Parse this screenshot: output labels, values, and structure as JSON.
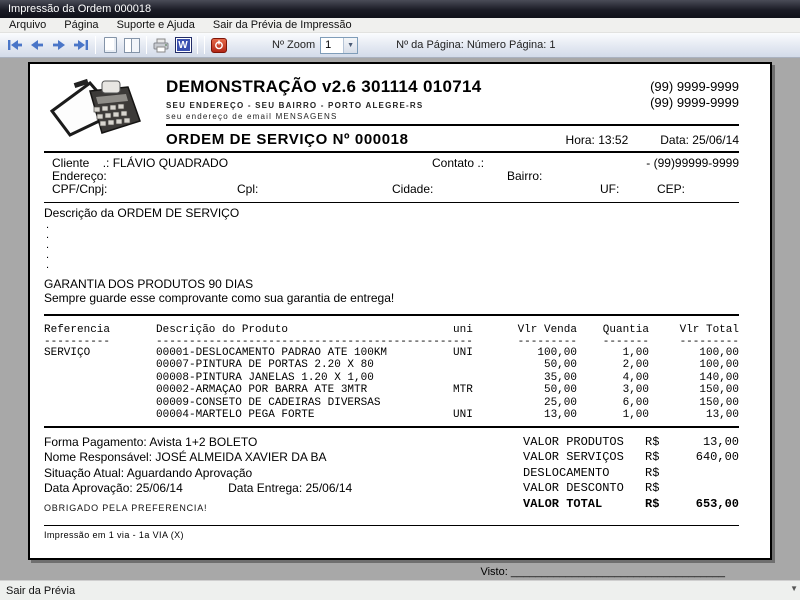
{
  "window": {
    "title": "Impressão da Ordem 000018",
    "menu": [
      "Arquivo",
      "Página",
      "Suporte e Ajuda",
      "Sair da Prévia de Impressão"
    ],
    "toolbar": {
      "zoom_label": "Nº Zoom",
      "zoom_value": "1",
      "page_info": "Nº da Página: Número Página: 1"
    },
    "status": "Sair da Prévia"
  },
  "doc": {
    "company": {
      "title": "DEMONSTRAÇÃO v2.6 301114 010714",
      "address": "SEU ENDEREÇO - SEU BAIRRO - PORTO ALEGRE-RS",
      "email": "seu endereço de email MENSAGENS",
      "phone1": "(99) 9999-9999",
      "phone2": "(99) 9999-9999"
    },
    "order": {
      "title": "ORDEM DE SERVIÇO Nº 000018",
      "time": "Hora: 13:52",
      "date": "Data: 25/06/14"
    },
    "client": {
      "cliente_label": "Cliente    .: ",
      "cliente_value": "FLÁVIO QUADRADO",
      "contato_label": "Contato .:",
      "contato_phone": "- (99)99999-9999",
      "endereco_label": "Endereço:",
      "bairro_label": "Bairro:",
      "cpf_label": "CPF/Cnpj:",
      "cpl_label": "Cpl:",
      "cidade_label": "Cidade:",
      "uf_label": "UF:",
      "cep_label": "CEP:"
    },
    "description": {
      "title": "Descrição da ORDEM DE SERVIÇO",
      "dots": [
        ".",
        ".",
        ".",
        ".",
        "."
      ],
      "garantia1": "GARANTIA DOS PRODUTOS 90 DIAS",
      "garantia2": "Sempre guarde esse comprovante como sua garantia de entrega!"
    },
    "table": {
      "headers": [
        "Referencia",
        "Descrição do Produto",
        "uni",
        "Vlr Venda",
        "Quantia",
        "Vlr Total"
      ],
      "dashes": [
        "----------",
        "----------------------------------------------",
        "---",
        "---------",
        "-------",
        "---------"
      ],
      "rows": [
        [
          "SERVIÇO",
          "00001-DESLOCAMENTO PADRAO ATE 100KM",
          "UNI",
          "100,00",
          "1,00",
          "100,00"
        ],
        [
          "",
          "00007-PINTURA DE PORTAS 2.20 X 80",
          "",
          "50,00",
          "2,00",
          "100,00"
        ],
        [
          "",
          "00008-PINTURA JANELAS 1.20 X 1,00",
          "",
          "35,00",
          "4,00",
          "140,00"
        ],
        [
          "",
          "00002-ARMAÇÃO POR BARRA ATE 3MTR",
          "MTR",
          "50,00",
          "3,00",
          "150,00"
        ],
        [
          "",
          "00009-CONSETO DE CADEIRAS DIVERSAS",
          "",
          "25,00",
          "6,00",
          "150,00"
        ],
        [
          "",
          "00004-MARTELO PEGA FORTE",
          "UNI",
          "13,00",
          "1,00",
          "13,00"
        ]
      ]
    },
    "footer": {
      "pagamento": "Forma Pagamento: Avista 1+2 BOLETO",
      "responsavel": "Nome Responsável: JOSÉ ALMEIDA XAVIER DA BA",
      "situacao": "Situação Atual: Aguardando Aprovação",
      "aprovacao": "Data Aprovação: 25/06/14",
      "entrega": "Data Entrega: 25/06/14",
      "obrigado": "OBRIGADO PELA PREFERENCIA!",
      "totals": [
        {
          "label": "VALOR PRODUTOS",
          "currency": "R$",
          "value": "13,00",
          "bold": false
        },
        {
          "label": "VALOR SERVIÇOS",
          "currency": "R$",
          "value": "640,00",
          "bold": false
        },
        {
          "label": "DESLOCAMENTO",
          "currency": "R$",
          "value": "",
          "bold": false
        },
        {
          "label": "VALOR DESCONTO",
          "currency": "R$",
          "value": "",
          "bold": false
        },
        {
          "label": "VALOR TOTAL",
          "currency": "R$",
          "value": "653,00",
          "bold": true
        }
      ],
      "via": "Impressão em 1 via  -  1a VIA (X)",
      "visto_label": "Visto: ",
      "visto_line": "___________________________________"
    },
    "colors": {
      "nav_arrow": "#4a76c8",
      "word_icon_bg": "#3a50b0",
      "power_icon_bg": "#b22717"
    }
  }
}
